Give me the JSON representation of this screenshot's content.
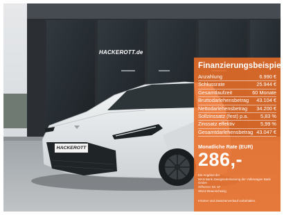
{
  "dealership": {
    "sign_text": "HACKEROTT.de",
    "plate_text": "HACKEROTT"
  },
  "financing": {
    "title": "Finanzierungsbeispiel",
    "rows": [
      {
        "label": "Anzahlung",
        "value": "6.990 €"
      },
      {
        "label": "Schlussrate",
        "value": "25.944 €"
      },
      {
        "label": "Gesamtlaufzeit",
        "value": "60 Monate"
      },
      {
        "label": "Bruttodarlehensbetrag",
        "value": "43.104 €"
      },
      {
        "label": "Nettodarlehensbetrag",
        "value": "34.200 €"
      },
      {
        "label": "Sollzinssatz (fest) p.a.",
        "value": "5,83 %"
      },
      {
        "label": "Zinssatz effektiv",
        "value": "5,99 %"
      },
      {
        "label": "Gesamtdarlehensbetrag",
        "value": "43.047 €"
      }
    ],
    "rate_label": "Monatliche Rate (EUR)",
    "rate_value": "286,-",
    "provider_lines": [
      "Ein Angebot der",
      "MAN Bank Zweigniederlassung der Volkswagen Bank",
      "GmbH",
      "Gifhorner Str. 57",
      "38112 Braunschweig"
    ],
    "disclaimer": "Irrtümer und Zwischenverkauf vorbehalten."
  },
  "colors": {
    "panel": "#ea6e28",
    "car_body": "#e9ecee",
    "building": "#2b2f33"
  }
}
